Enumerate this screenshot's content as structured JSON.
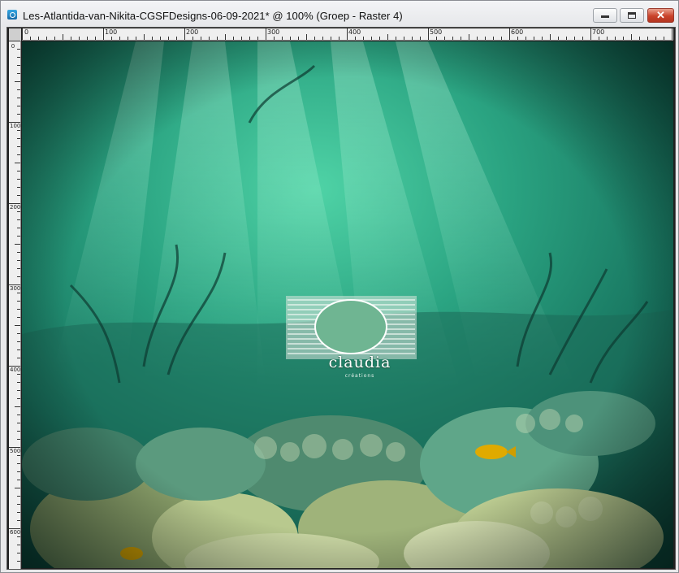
{
  "window": {
    "title": "Les-Atlantida-van-Nikita-CGSFDesigns-06-09-2021* @ 100% (Groep - Raster 4)",
    "controls": {
      "minimize": "minimize-icon",
      "maximize": "maximize-icon",
      "close": "✕"
    }
  },
  "rulers": {
    "horizontal": [
      "0",
      "100",
      "200",
      "300",
      "400",
      "500",
      "600",
      "700"
    ],
    "vertical": [
      "0",
      "100",
      "200",
      "300",
      "400",
      "500",
      "600"
    ]
  },
  "canvas": {
    "watermark_text": "claudia",
    "watermark_sub": "créations",
    "palette": {
      "water_light": "#3fbf95",
      "water_mid": "#1f8f73",
      "water_dark": "#0b3a33",
      "coral": "#c9d6a4",
      "fish": "#e8b300"
    }
  }
}
